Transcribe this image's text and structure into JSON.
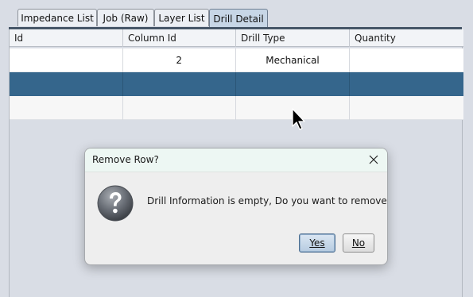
{
  "tabs": [
    {
      "label": "Impedance List",
      "active": false
    },
    {
      "label": "Job (Raw)",
      "active": false
    },
    {
      "label": "Layer List",
      "active": false
    },
    {
      "label": "Drill Detail",
      "active": true
    }
  ],
  "table": {
    "columns": [
      "Id",
      "Column Id",
      "Drill Type",
      "Quantity"
    ],
    "rows": [
      {
        "id": "",
        "column_id": "2",
        "drill_type": "Mechanical",
        "quantity": "",
        "state": "normal"
      },
      {
        "id": "",
        "column_id": "",
        "drill_type": "",
        "quantity": "",
        "state": "selected"
      },
      {
        "id": "",
        "column_id": "",
        "drill_type": "",
        "quantity": "",
        "state": "normal"
      }
    ]
  },
  "dialog": {
    "title": "Remove Row?",
    "message": "Drill Information is empty, Do you want to remove row",
    "icon": "question-icon",
    "buttons": {
      "yes_label": "Yes",
      "no_label": "No"
    }
  },
  "colors": {
    "selected_row": "#35668c",
    "active_tab": "#c7d6e6",
    "background": "#d9dde5"
  }
}
